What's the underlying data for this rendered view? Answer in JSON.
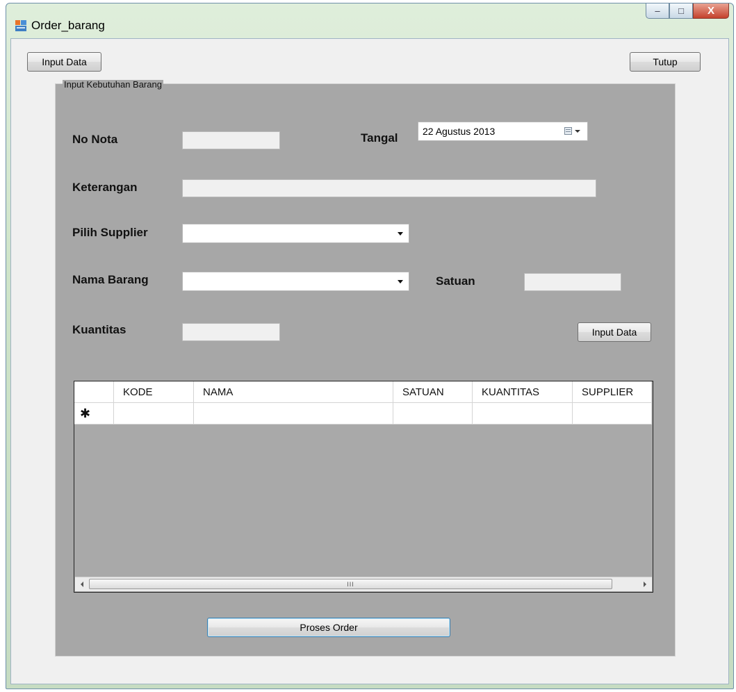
{
  "window": {
    "title": "Order_barang",
    "caption_buttons": {
      "minimize": "–",
      "maximize": "□",
      "close": "X"
    }
  },
  "toolbar": {
    "input_data_label": "Input Data",
    "tutup_label": "Tutup"
  },
  "group": {
    "title": "Input Kebutuhan Barang",
    "fields": {
      "no_nota_label": "No Nota",
      "no_nota_value": "",
      "tangal_label": "Tangal",
      "tangal_value": "22  Agustus  2013",
      "keterangan_label": "Keterangan",
      "keterangan_value": "",
      "pilih_supplier_label": "Pilih Supplier",
      "pilih_supplier_value": "",
      "nama_barang_label": "Nama Barang",
      "nama_barang_value": "",
      "satuan_label": "Satuan",
      "satuan_value": "",
      "kuantitas_label": "Kuantitas",
      "kuantitas_value": ""
    },
    "input_data_label": "Input Data",
    "grid": {
      "columns": [
        "KODE",
        "NAMA",
        "SATUAN",
        "KUANTITAS",
        "SUPPLIER"
      ],
      "new_row_marker": "✱",
      "scroll_grip": "III"
    },
    "proses_order_label": "Proses Order"
  },
  "icons": {
    "app": "form-icon",
    "calendar": "calendar-icon",
    "dropdown": "chevron-down-icon"
  },
  "colors": {
    "window_frame": "#cfe4c9",
    "client_bg": "#f0f0f0",
    "group_bg": "#a7a7a7",
    "close_button": "#c4412c"
  }
}
